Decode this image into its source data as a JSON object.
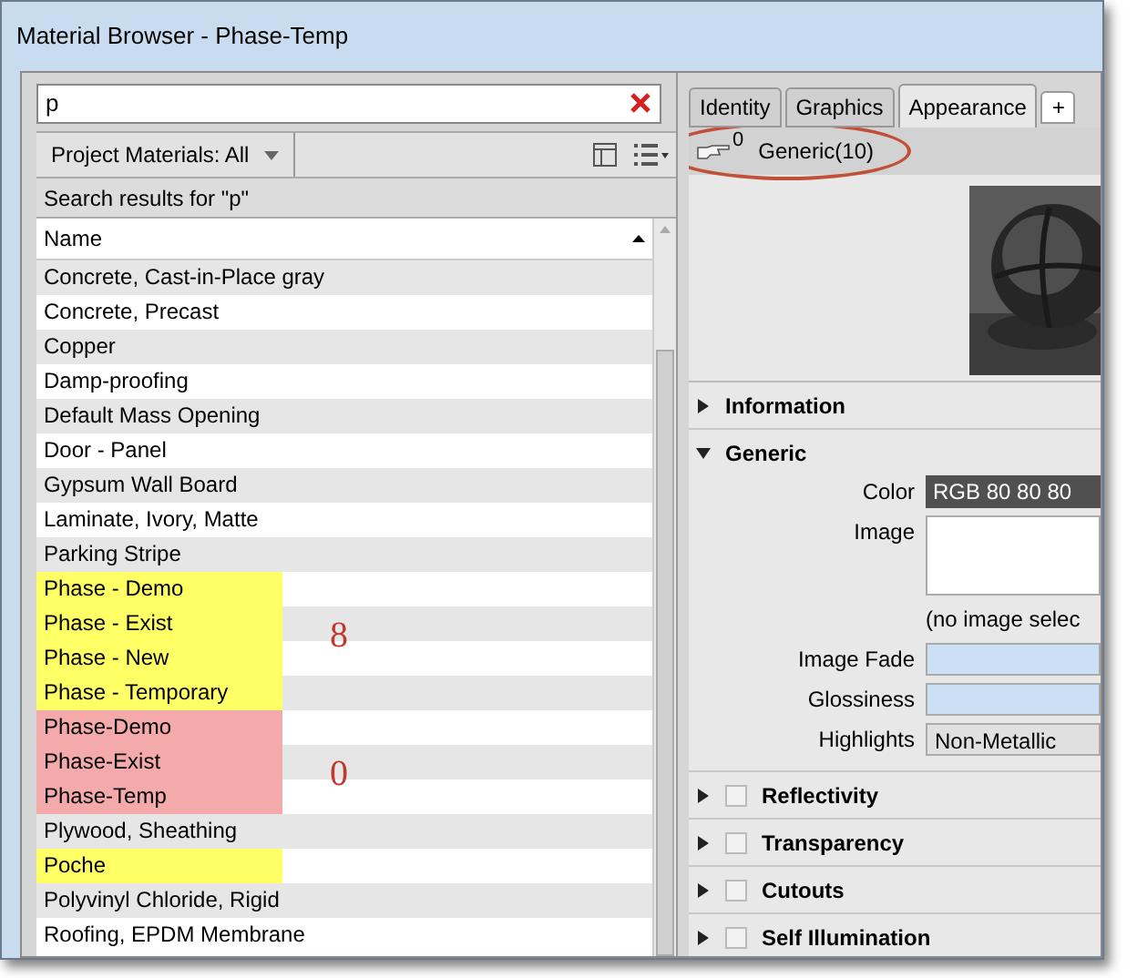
{
  "window": {
    "title": "Material Browser - Phase-Temp"
  },
  "search": {
    "value": "p"
  },
  "library_bar": {
    "label": "Project Materials: All"
  },
  "results_label": "Search results for \"p\"",
  "table": {
    "columns": [
      {
        "label": "Name"
      }
    ],
    "rows": [
      {
        "name": "Concrete, Cast-in-Place gray"
      },
      {
        "name": "Concrete, Precast"
      },
      {
        "name": "Copper"
      },
      {
        "name": "Damp-proofing"
      },
      {
        "name": "Default Mass Opening"
      },
      {
        "name": "Door - Panel"
      },
      {
        "name": "Gypsum Wall Board"
      },
      {
        "name": "Laminate, Ivory, Matte"
      },
      {
        "name": "Parking Stripe"
      },
      {
        "name": "Phase - Demo",
        "color": "#ffff66"
      },
      {
        "name": "Phase - Exist",
        "color": "#ffff66",
        "annotation": "8"
      },
      {
        "name": "Phase - New",
        "color": "#ffff66"
      },
      {
        "name": "Phase - Temporary",
        "color": "#ffff66"
      },
      {
        "name": "Phase-Demo",
        "color": "#f4aaaa"
      },
      {
        "name": "Phase-Exist",
        "color": "#f4aaaa",
        "annotation": "0"
      },
      {
        "name": "Phase-Temp",
        "color": "#f4aaaa"
      },
      {
        "name": "Plywood, Sheathing"
      },
      {
        "name": "Poche",
        "color": "#ffff66"
      },
      {
        "name": "Polyvinyl Chloride, Rigid"
      },
      {
        "name": "Roofing, EPDM Membrane"
      }
    ]
  },
  "tabs": [
    {
      "label": "Identity",
      "selected": false
    },
    {
      "label": "Graphics",
      "selected": false
    },
    {
      "label": "Appearance",
      "selected": true
    },
    {
      "label": "+",
      "selected": false
    }
  ],
  "asset": {
    "count": "0",
    "name": "Generic(10)"
  },
  "sections": [
    {
      "title": "Information",
      "expanded": false,
      "kind": "plain"
    },
    {
      "title": "Generic",
      "expanded": true,
      "kind": "plain",
      "properties": [
        {
          "kind": "color",
          "label": "Color",
          "value": "RGB 80 80 80"
        },
        {
          "label": "Image",
          "note": "(no image selec"
        },
        {
          "kind": "slider",
          "label": "Image Fade"
        },
        {
          "kind": "slider",
          "label": "Glossiness"
        },
        {
          "kind": "dropdown",
          "label": "Highlights",
          "value": "Non-Metallic"
        }
      ]
    },
    {
      "title": "Reflectivity",
      "expanded": false,
      "kind": "checkable",
      "checked": false
    },
    {
      "title": "Transparency",
      "expanded": false,
      "kind": "checkable",
      "checked": false
    },
    {
      "title": "Cutouts",
      "expanded": false,
      "kind": "checkable",
      "checked": false
    },
    {
      "title": "Self Illumination",
      "expanded": false,
      "kind": "checkable",
      "checked": false
    }
  ]
}
